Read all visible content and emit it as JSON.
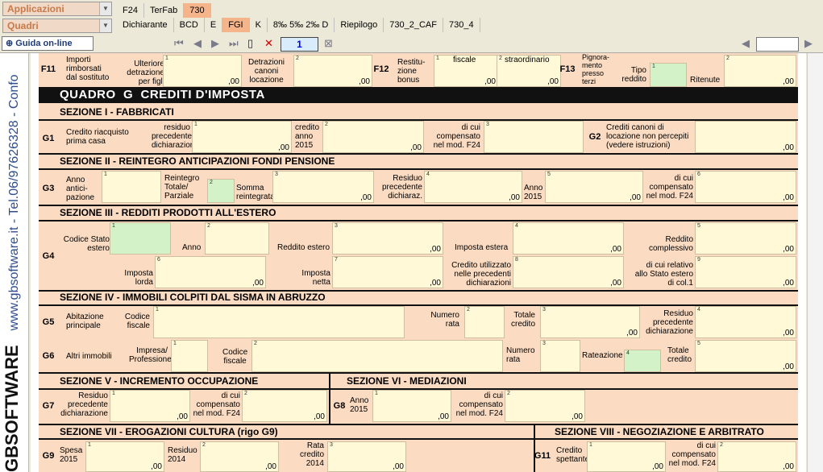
{
  "dropdowns": {
    "applicazioni": "Applicazioni",
    "quadri": "Quadri"
  },
  "tabs_row1": [
    "F24",
    "TerFab",
    "730"
  ],
  "tabs_row2": [
    "Dichiarante",
    "BCD",
    "E",
    "FGI",
    "K",
    "8‰ 5‰ 2‰ D",
    "Riepilogo",
    "730_2_CAF",
    "730_4"
  ],
  "toolbar": {
    "guida": "Guida on-line",
    "page": "1"
  },
  "sidebar": {
    "brand": "GBSOFTWARE",
    "contact": "www.gbsoftware.it - Tel.06/97626328 - Confo"
  },
  "zero": ",00",
  "f11": {
    "code": "F11",
    "l1": "Importi\nrimborsati\ndal sostituto",
    "l2": "Ulteriore\ndetrazione\nper figli",
    "l3": "Detrazioni\ncanoni\nlocazione"
  },
  "f12": {
    "code": "F12",
    "l1": "Restitu-\nzione\nbonus",
    "l2": "fiscale",
    "l3": "straordinario"
  },
  "f13": {
    "code": "F13",
    "l1": "Pignora-\nmento\npresso\nterzi",
    "l2": "Tipo\nreddito",
    "l3": "Ritenute"
  },
  "quadro_title": "QUADRO  G  CREDITI D'IMPOSTA",
  "s1": {
    "title": "SEZIONE I  -  FABBRICATI",
    "g1": "G1",
    "g1a": "Credito riacquisto\nprima casa",
    "g1b": "residuo\nprecedente\ndichiarazione",
    "g1c": "credito\nanno\n2015",
    "g1d": "di cui\ncompensato\nnel mod. F24",
    "g2": "G2",
    "g2a": "Crediti canoni di\nlocazione non percepiti\n(vedere istruzioni)"
  },
  "s2": {
    "title": "SEZIONE II  -  REINTEGRO ANTICIPAZIONI FONDI PENSIONE",
    "g3": "G3",
    "a": "Anno\nantici-\npazione",
    "b": "Reintegro\nTotale/\nParziale",
    "c": "Somma\nreintegrata",
    "d": "Residuo\nprecedente\ndichiaraz.",
    "e": "Anno\n2015",
    "f": "di cui\ncompensato\nnel mod. F24"
  },
  "s3": {
    "title": "SEZIONE III  -  REDDITI PRODOTTI ALL'ESTERO",
    "g4": "G4",
    "a": "Codice Stato\nestero",
    "b": "Anno",
    "c": "Reddito estero",
    "d": "Imposta estera",
    "e": "Reddito\ncomplessivo",
    "f": "Imposta\nlorda",
    "g": "Imposta\nnetta",
    "h": "Credito utilizzato\nnelle precedenti\ndichiarazioni",
    "i": "di cui relativo\nallo Stato estero\ndi col.1"
  },
  "s4": {
    "title": "SEZIONE IV  -  IMMOBILI COLPITI DAL SISMA IN ABRUZZO",
    "g5": "G5",
    "a": "Abitazione\nprincipale",
    "b": "Codice\nfiscale",
    "c": "Numero\nrata",
    "d": "Totale\ncredito",
    "e": "Residuo\nprecedente\ndichiarazione",
    "g6": "G6",
    "f": "Altri immobili",
    "g": "Impresa/\nProfessione",
    "h": "Codice\nfiscale",
    "i": "Numero\nrata",
    "j": "Rateazione",
    "k": "Totale\ncredito"
  },
  "s5": {
    "title": "SEZIONE V  -  INCREMENTO OCCUPAZIONE",
    "g7": "G7",
    "a": "Residuo\nprecedente\ndichiarazione",
    "b": "di cui\ncompensato\nnel mod. F24"
  },
  "s6": {
    "title": "SEZIONE VI  -  MEDIAZIONI",
    "g8": "G8",
    "a": "Anno\n2015",
    "b": "di cui\ncompensato\nnel mod. F24"
  },
  "s7": {
    "title": "SEZIONE VII  -  EROGAZIONI CULTURA (rigo G9)",
    "g9": "G9",
    "a": "Spesa\n2015",
    "b": "Residuo\n2014",
    "c": "Rata\ncredito\n2014"
  },
  "s8": {
    "title": "SEZIONE VIII  -  NEGOZIAZIONE E ARBITRATO",
    "g11": "G11",
    "a": "Credito\nspettante",
    "b": "di cui\ncompensato\nnel mod. F24"
  }
}
